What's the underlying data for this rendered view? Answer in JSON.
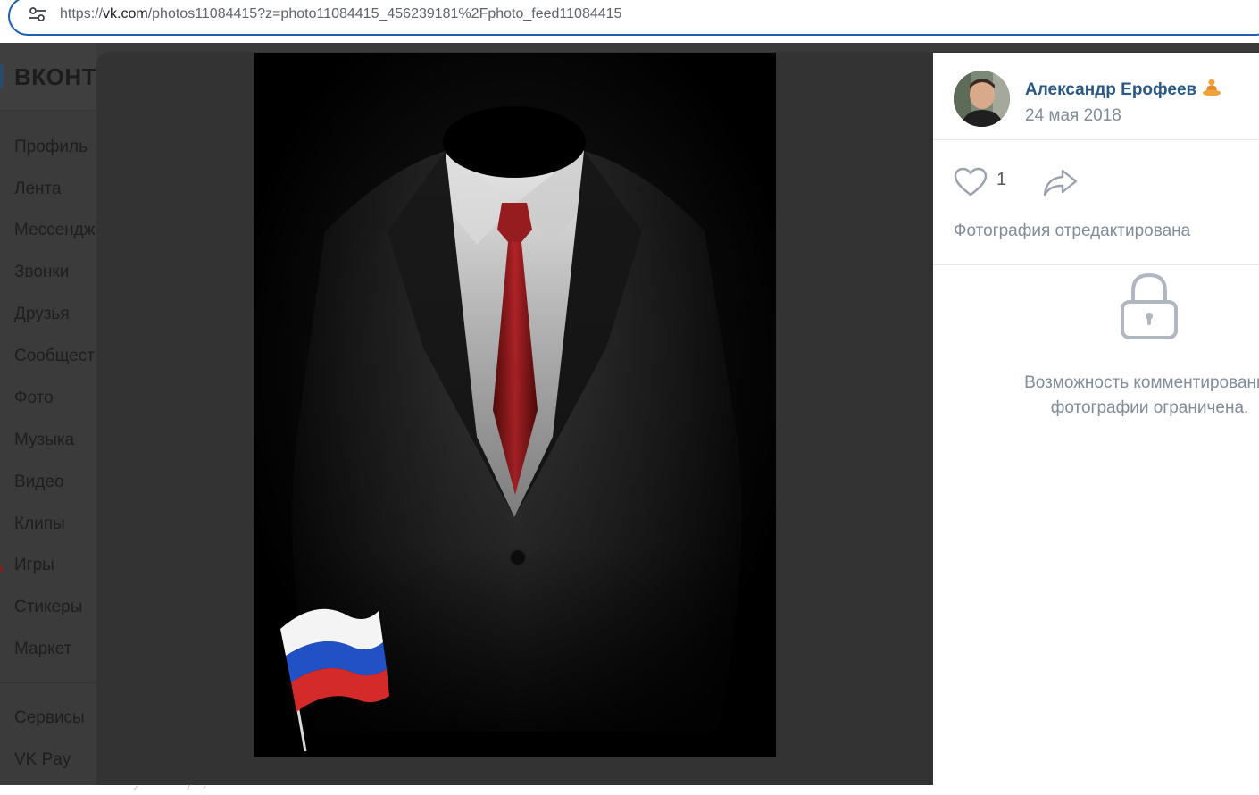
{
  "browser": {
    "url_prefix": "https://",
    "url_domain": "vk.com",
    "url_rest": "/photos11084415?z=photo11084415_456239181%2Fphoto_feed11084415",
    "site_info_icon": "tune-icon"
  },
  "vk": {
    "brand": "ВКОНТ",
    "menu": [
      "Профиль",
      "Лента",
      "Мессендж",
      "Звонки",
      "Друзья",
      "Сообщест",
      "Фото",
      "Музыка",
      "Видео",
      "Клипы",
      "Игры",
      "Стикеры",
      "Маркет"
    ],
    "menu_secondary": [
      "Сервисы",
      "VK Pay"
    ]
  },
  "viewer": {
    "author_name": "Александр Ерофеев",
    "author_emoji": "🧘",
    "date": "24 мая 2018",
    "like_count": "1",
    "edited_note": "Фотография отредактирована",
    "comments_locked_line1": "Возможность комментирования",
    "comments_locked_line2": "фотографии ограничена.",
    "colors": {
      "link": "#2a5885",
      "secondary_text": "#818c99",
      "icon": "#99a2ad",
      "backdrop": "#333333"
    }
  }
}
